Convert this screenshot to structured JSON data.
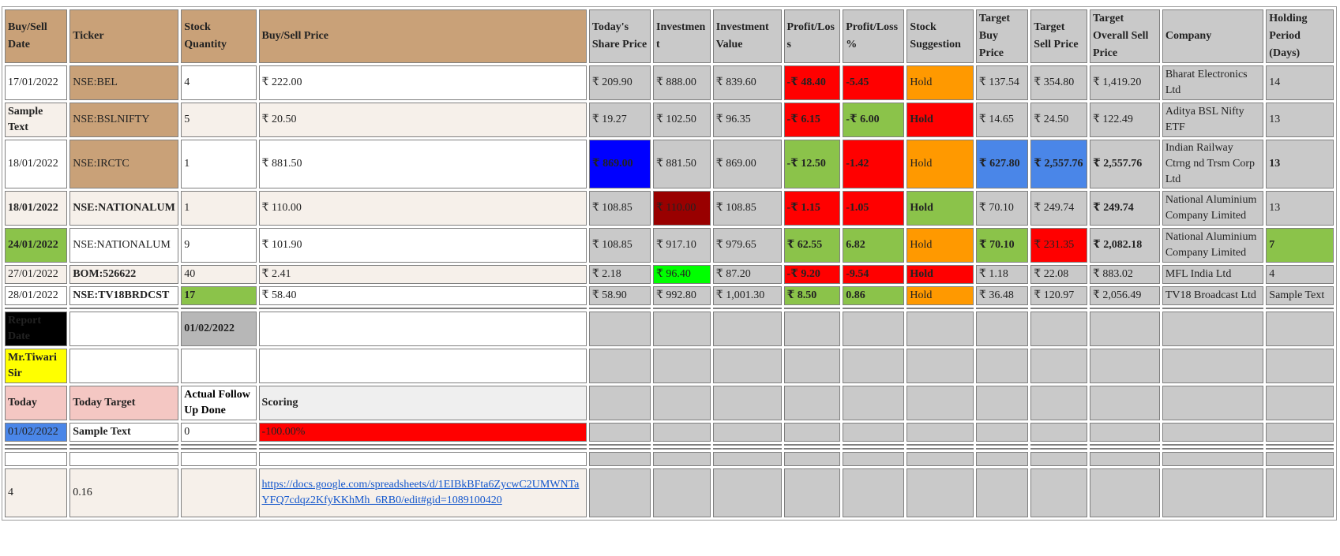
{
  "headers": {
    "buy_sell_date": "Buy/Sell Date",
    "ticker": "Ticker",
    "stock_quantity": "Stock Quantity",
    "buy_sell_price": "Buy/Sell Price",
    "todays_share_price": "Today's Share Price",
    "investment": "Investment",
    "investment_value": "Investment Value",
    "profit_loss": "Profit/Loss",
    "profit_loss_pct": "Profit/Loss %",
    "stock_suggestion": "Stock Suggestion",
    "target_buy_price": "Target Buy Price",
    "target_sell_price": "Target Sell Price",
    "target_overall_sell_price": "Target Overall Sell Price",
    "company": "Company",
    "holding_period": "Holding Period (Days)"
  },
  "rows": [
    {
      "date": "17/01/2022",
      "ticker": "NSE:BEL",
      "qty": "4",
      "price": "₹ 222.00",
      "today": "₹ 209.90",
      "investment": "₹ 888.00",
      "inv_value": "₹ 839.60",
      "pl": "-₹ 48.40",
      "pl_pct": "-5.45",
      "suggestion": "Hold",
      "target_buy": "₹ 137.54",
      "target_sell": "₹ 354.80",
      "target_overall": "₹ 1,419.20",
      "company": "Bharat Electronics Ltd",
      "holding": "14"
    },
    {
      "date": "Sample Text",
      "ticker": "NSE:BSLNIFTY",
      "qty": "5",
      "price": "₹ 20.50",
      "today": "₹ 19.27",
      "investment": "₹ 102.50",
      "inv_value": "₹ 96.35",
      "pl": "-₹ 6.15",
      "pl_pct": "-₹ 6.00",
      "suggestion": "Hold",
      "target_buy": "₹ 14.65",
      "target_sell": "₹ 24.50",
      "target_overall": "₹ 122.49",
      "company": "Aditya BSL Nifty ETF",
      "holding": "13"
    },
    {
      "date": "18/01/2022",
      "ticker": "NSE:IRCTC",
      "qty": "1",
      "price": "₹ 881.50",
      "today": "₹ 869.00",
      "investment": "₹ 881.50",
      "inv_value": "₹ 869.00",
      "pl": "-₹ 12.50",
      "pl_pct": "-1.42",
      "suggestion": "Hold",
      "target_buy": "₹ 627.80",
      "target_sell": "₹ 2,557.76",
      "target_overall": "₹ 2,557.76",
      "company": "Indian Railway Ctrng nd Trsm Corp Ltd",
      "holding": "13"
    },
    {
      "date": "18/01/2022",
      "ticker": "NSE:NATIONALUM",
      "qty": "1",
      "price": "₹ 110.00",
      "today": "₹ 108.85",
      "investment": "₹ 110.00",
      "inv_value": "₹ 108.85",
      "pl": "-₹ 1.15",
      "pl_pct": "-1.05",
      "suggestion": "Hold",
      "target_buy": "₹ 70.10",
      "target_sell": "₹ 249.74",
      "target_overall": "₹ 249.74",
      "company": "National Aluminium Company Limited",
      "holding": "13"
    },
    {
      "date": "24/01/2022",
      "ticker": "NSE:NATIONALUM",
      "qty": "9",
      "price": "₹ 101.90",
      "today": "₹ 108.85",
      "investment": "₹ 917.10",
      "inv_value": "₹ 979.65",
      "pl": "₹ 62.55",
      "pl_pct": "6.82",
      "suggestion": "Hold",
      "target_buy": "₹ 70.10",
      "target_sell": "₹ 231.35",
      "target_overall": "₹ 2,082.18",
      "company": "National Aluminium Company Limited",
      "holding": "7"
    },
    {
      "date": "27/01/2022",
      "ticker": "BOM:526622",
      "qty": "40",
      "price": "₹ 2.41",
      "today": "₹ 2.18",
      "investment": "₹ 96.40",
      "inv_value": "₹ 87.20",
      "pl": "-₹ 9.20",
      "pl_pct": "-9.54",
      "suggestion": "Hold",
      "target_buy": "₹ 1.18",
      "target_sell": "₹ 22.08",
      "target_overall": "₹ 883.02",
      "company": "MFL India Ltd",
      "holding": "4"
    },
    {
      "date": "28/01/2022",
      "ticker": "NSE:TV18BRDCST",
      "qty": "17",
      "price": "₹ 58.40",
      "today": "₹ 58.90",
      "investment": "₹ 992.80",
      "inv_value": "₹ 1,001.30",
      "pl": "₹ 8.50",
      "pl_pct": "0.86",
      "suggestion": "Hold",
      "target_buy": "₹ 36.48",
      "target_sell": "₹ 120.97",
      "target_overall": "₹ 2,056.49",
      "company": "TV18 Broadcast Ltd",
      "holding": "Sample Text"
    }
  ],
  "report": {
    "report_date_label": "Report Date",
    "report_date_value": "01/02/2022",
    "person_label": "Mr.Tiwari Sir",
    "today_label": "Today",
    "today_target_label": "Today Target",
    "actual_follow_up_label": "Actual Follow Up Done",
    "scoring_label": "Scoring",
    "today_value": "01/02/2022",
    "today_target_value": "Sample Text",
    "actual_follow_up_value": "0",
    "scoring_value": "-100.00%",
    "footer_count": "4",
    "footer_ratio": "0.16",
    "footer_link": "https://docs.google.com/spreadsheets/d/1EIBkBFta6ZycwC2UMWNTaYFQ7cdqz2KfyKKhMh_6RB0/edit#gid=1089100420"
  },
  "colors": {
    "header_tan": "#c9a178",
    "grey": "#c9c9c9",
    "loss_red": "#ff0000",
    "gain_green": "#8bc34a",
    "hold_orange": "#ff9900",
    "blue": "#0000ff",
    "light_blue": "#4a86e8",
    "dark_red": "#990000",
    "lime": "#00ff00",
    "pink": "#f4c7c3",
    "yellow": "#ffff00"
  }
}
